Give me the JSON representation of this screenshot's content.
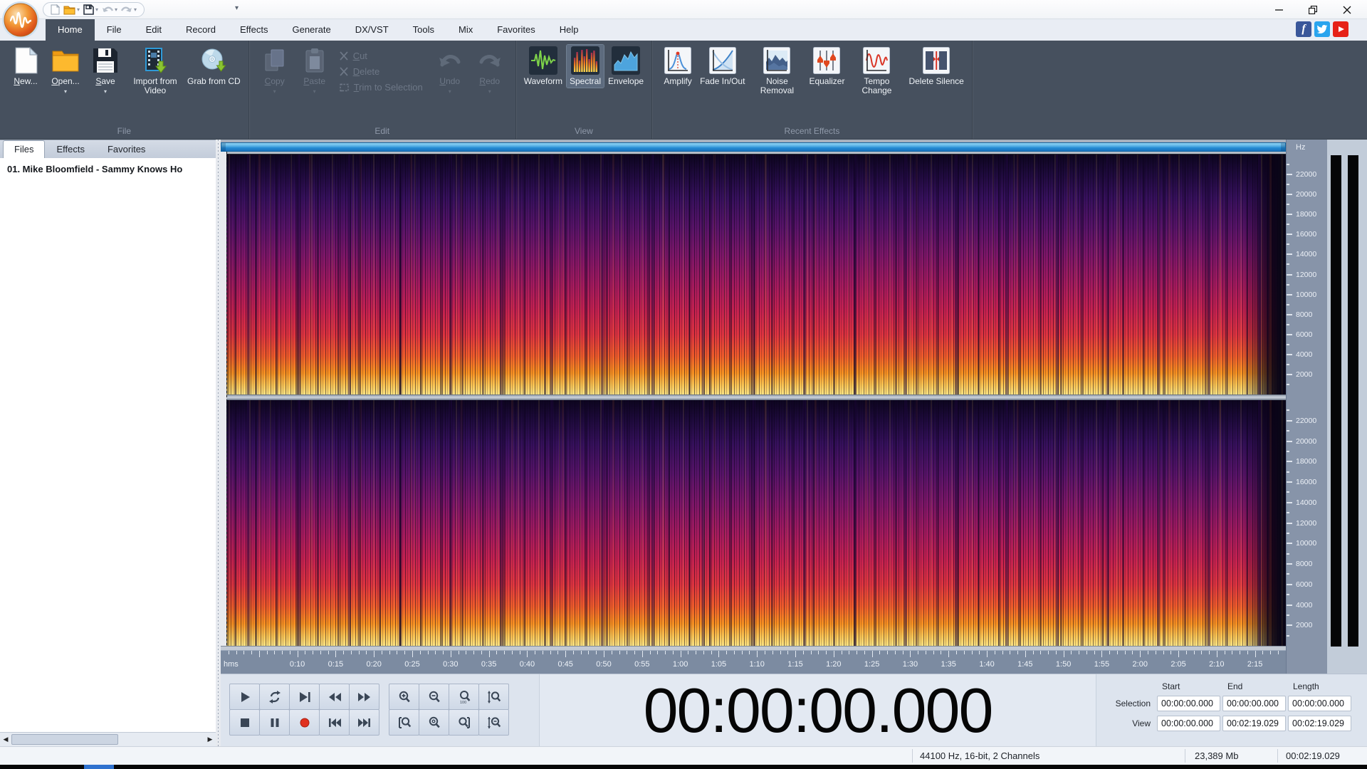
{
  "titlebar": {
    "quick_access": [
      {
        "icon": "qat-new-icon",
        "dropdown": false,
        "disabled": false
      },
      {
        "icon": "qat-open-icon",
        "dropdown": true,
        "disabled": false
      },
      {
        "icon": "qat-save-icon",
        "dropdown": true,
        "disabled": false
      },
      {
        "icon": "qat-undo-icon",
        "dropdown": true,
        "disabled": true
      },
      {
        "icon": "qat-redo-icon",
        "dropdown": true,
        "disabled": true
      }
    ],
    "window_controls": [
      "minimize",
      "restore",
      "close"
    ]
  },
  "menu": {
    "tabs": [
      "Home",
      "File",
      "Edit",
      "Record",
      "Effects",
      "Generate",
      "DX/VST",
      "Tools",
      "Mix",
      "Favorites",
      "Help"
    ],
    "active_tab": "Home",
    "social": [
      "facebook",
      "twitter",
      "youtube"
    ]
  },
  "ribbon": {
    "groups": [
      {
        "label": "File",
        "items": [
          {
            "kind": "big",
            "label": "New...",
            "icon": "new-file-icon",
            "accel": true,
            "enabled": true
          },
          {
            "kind": "big",
            "label": "Open...",
            "icon": "open-folder-icon",
            "accel": true,
            "enabled": true,
            "dropdown": true
          },
          {
            "kind": "big",
            "label": "Save",
            "icon": "save-icon",
            "accel": true,
            "enabled": true,
            "dropdown": true
          },
          {
            "kind": "big",
            "label": "Import from Video",
            "icon": "import-video-icon",
            "enabled": true
          },
          {
            "kind": "big",
            "label": "Grab from CD",
            "icon": "grab-cd-icon",
            "enabled": true
          }
        ]
      },
      {
        "label": "Edit",
        "items": [
          {
            "kind": "big",
            "label": "Copy",
            "icon": "copy-icon",
            "accel": true,
            "enabled": false,
            "dropdown": true
          },
          {
            "kind": "big",
            "label": "Paste",
            "icon": "paste-icon",
            "accel": true,
            "enabled": false,
            "dropdown": true
          },
          {
            "kind": "stack",
            "items": [
              {
                "label": "Cut",
                "icon": "cut-icon",
                "accel": true
              },
              {
                "label": "Delete",
                "icon": "delete-icon",
                "accel": true
              },
              {
                "label": "Trim to Selection",
                "icon": "trim-icon",
                "accel": true
              }
            ]
          },
          {
            "kind": "big",
            "label": "Undo",
            "icon": "undo-icon",
            "accel": true,
            "enabled": false,
            "dropdown": true
          },
          {
            "kind": "big",
            "label": "Redo",
            "icon": "redo-icon",
            "accel": true,
            "enabled": false,
            "dropdown": true
          }
        ]
      },
      {
        "label": "View",
        "items": [
          {
            "kind": "big",
            "label": "Waveform",
            "icon": "waveform-icon",
            "enabled": true
          },
          {
            "kind": "big",
            "label": "Spectral",
            "icon": "spectral-icon",
            "enabled": true,
            "active": true
          },
          {
            "kind": "big",
            "label": "Envelope",
            "icon": "envelope-icon",
            "enabled": true
          }
        ]
      },
      {
        "label": "Recent Effects",
        "items": [
          {
            "kind": "big",
            "label": "Amplify",
            "icon": "amplify-icon",
            "enabled": true
          },
          {
            "kind": "big",
            "label": "Fade In/Out",
            "icon": "fade-icon",
            "enabled": true
          },
          {
            "kind": "big",
            "label": "Noise Removal",
            "icon": "noise-removal-icon",
            "enabled": true
          },
          {
            "kind": "big",
            "label": "Equalizer",
            "icon": "equalizer-icon",
            "enabled": true
          },
          {
            "kind": "big",
            "label": "Tempo Change",
            "icon": "tempo-icon",
            "enabled": true
          },
          {
            "kind": "big",
            "label": "Delete Silence",
            "icon": "delete-silence-icon",
            "enabled": true
          }
        ]
      }
    ]
  },
  "left_panel": {
    "tabs": [
      "Files",
      "Effects",
      "Favorites"
    ],
    "active_tab": "Files",
    "files": [
      "01. Mike Bloomfield - Sammy Knows Ho"
    ]
  },
  "spectral_view": {
    "freq_unit": "Hz",
    "freq_tick_labels": [
      22000,
      20000,
      18000,
      16000,
      14000,
      12000,
      10000,
      8000,
      6000,
      4000,
      2000
    ],
    "channels": 2
  },
  "timeline": {
    "unit_label": "hms",
    "duration_seconds": 139.029,
    "first_label_seconds": 10,
    "label_interval_seconds": 5,
    "tick_labels": [
      "0:10",
      "0:15",
      "0:20",
      "0:25",
      "0:30",
      "0:35",
      "0:40",
      "0:45",
      "0:50",
      "0:55",
      "1:00",
      "1:05",
      "1:10",
      "1:15",
      "1:20",
      "1:25",
      "1:30",
      "1:35",
      "1:40",
      "1:45",
      "1:50",
      "1:55",
      "2:00",
      "2:05",
      "2:10",
      "2:15"
    ]
  },
  "transport": {
    "rows": [
      [
        {
          "name": "play-button",
          "icon": "play"
        },
        {
          "name": "loop-button",
          "icon": "loop"
        },
        {
          "name": "play-to-end-button",
          "icon": "play-to-end"
        },
        {
          "name": "rewind-button",
          "icon": "rewind"
        },
        {
          "name": "fast-forward-button",
          "icon": "fast-forward"
        },
        {
          "name": "zoom-in-button",
          "icon": "zoom-in"
        },
        {
          "name": "zoom-out-button",
          "icon": "zoom-out"
        },
        {
          "name": "zoom-100-button",
          "icon": "zoom-100"
        },
        {
          "name": "zoom-vertical-in-button",
          "icon": "zoom-vertical-in"
        }
      ],
      [
        {
          "name": "stop-button",
          "icon": "stop"
        },
        {
          "name": "pause-button",
          "icon": "pause"
        },
        {
          "name": "record-button",
          "icon": "record"
        },
        {
          "name": "go-to-start-button",
          "icon": "go-to-start"
        },
        {
          "name": "go-to-end-button",
          "icon": "go-to-end"
        },
        {
          "name": "zoom-selection-start-button",
          "icon": "zoom-selection-start"
        },
        {
          "name": "zoom-full-button",
          "icon": "zoom-full"
        },
        {
          "name": "zoom-selection-end-button",
          "icon": "zoom-selection-end"
        },
        {
          "name": "zoom-vertical-out-button",
          "icon": "zoom-vertical-out"
        }
      ]
    ]
  },
  "time_display": {
    "value": "00:00:00.000"
  },
  "position_panel": {
    "col_headers": [
      "Start",
      "End",
      "Length"
    ],
    "rows": [
      {
        "label": "Selection",
        "values": [
          "00:00:00.000",
          "00:00:00.000",
          "00:00:00.000"
        ]
      },
      {
        "label": "View",
        "values": [
          "00:00:00.000",
          "00:02:19.029",
          "00:02:19.029"
        ]
      }
    ]
  },
  "status_bar": {
    "format": "44100 Hz, 16-bit, 2 Channels",
    "size": "23,389 Mb",
    "length": "00:02:19.029"
  },
  "colors": {
    "ribbon_background": "#46505e",
    "accent_scrollbar_blue": "#2389d2",
    "record_red": "#e0301e",
    "spectrogram_palette": [
      "#0d051f",
      "#36105c",
      "#7d1668",
      "#c52150",
      "#ef5b2b",
      "#f79021",
      "#fbe383"
    ]
  }
}
